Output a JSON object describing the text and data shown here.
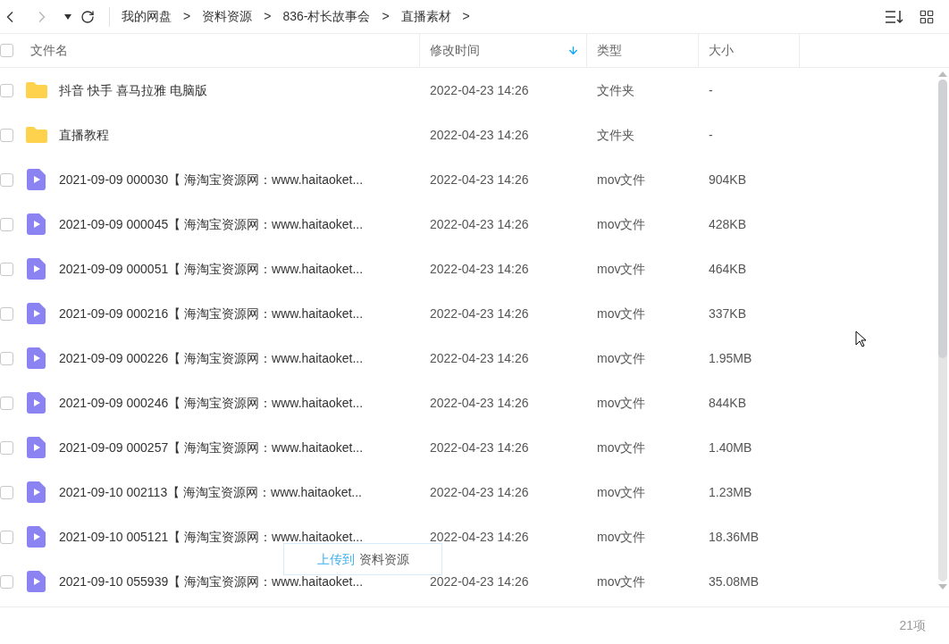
{
  "breadcrumb": [
    "我的网盘",
    "资料资源",
    "836-村长故事会",
    "直播素材"
  ],
  "breadcrumb_separator": ">",
  "columns": [
    {
      "label": "文件名",
      "sorted": false
    },
    {
      "label": "修改时间",
      "sorted": true
    },
    {
      "label": "类型",
      "sorted": false
    },
    {
      "label": "大小",
      "sorted": false
    }
  ],
  "rows": [
    {
      "kind": "folder",
      "name": "抖音 快手 喜马拉雅 电脑版",
      "modified": "2022-04-23 14:26",
      "type": "文件夹",
      "size": "-",
      "checked": false
    },
    {
      "kind": "folder",
      "name": "直播教程",
      "modified": "2022-04-23 14:26",
      "type": "文件夹",
      "size": "-",
      "checked": false
    },
    {
      "kind": "video",
      "name": "2021-09-09 000030【 海淘宝资源网：www.haitaoket...",
      "modified": "2022-04-23 14:26",
      "type": "mov文件",
      "size": "904KB",
      "checked": false
    },
    {
      "kind": "video",
      "name": "2021-09-09 000045【 海淘宝资源网：www.haitaoket...",
      "modified": "2022-04-23 14:26",
      "type": "mov文件",
      "size": "428KB",
      "checked": false
    },
    {
      "kind": "video",
      "name": "2021-09-09 000051【 海淘宝资源网：www.haitaoket...",
      "modified": "2022-04-23 14:26",
      "type": "mov文件",
      "size": "464KB",
      "checked": false
    },
    {
      "kind": "video",
      "name": "2021-09-09 000216【 海淘宝资源网：www.haitaoket...",
      "modified": "2022-04-23 14:26",
      "type": "mov文件",
      "size": "337KB",
      "checked": false
    },
    {
      "kind": "video",
      "name": "2021-09-09 000226【 海淘宝资源网：www.haitaoket...",
      "modified": "2022-04-23 14:26",
      "type": "mov文件",
      "size": "1.95MB",
      "checked": false
    },
    {
      "kind": "video",
      "name": "2021-09-09 000246【 海淘宝资源网：www.haitaoket...",
      "modified": "2022-04-23 14:26",
      "type": "mov文件",
      "size": "844KB",
      "checked": false
    },
    {
      "kind": "video",
      "name": "2021-09-09 000257【 海淘宝资源网：www.haitaoket...",
      "modified": "2022-04-23 14:26",
      "type": "mov文件",
      "size": "1.40MB",
      "checked": false
    },
    {
      "kind": "video",
      "name": "2021-09-10 002113【 海淘宝资源网：www.haitaoket...",
      "modified": "2022-04-23 14:26",
      "type": "mov文件",
      "size": "1.23MB",
      "checked": false
    },
    {
      "kind": "video",
      "name": "2021-09-10 005121【 海淘宝资源网：www.haitaoket...",
      "modified": "2022-04-23 14:26",
      "type": "mov文件",
      "size": "18.36MB",
      "checked": false
    },
    {
      "kind": "video",
      "name": "2021-09-10 055939【 海淘宝资源网：www.haitaoket...",
      "modified": "2022-04-23 14:26",
      "type": "mov文件",
      "size": "35.08MB",
      "checked": false
    }
  ],
  "drag_tooltip": {
    "action": "上传到",
    "target": "资料资源"
  },
  "status_bar": {
    "count": "21项"
  }
}
